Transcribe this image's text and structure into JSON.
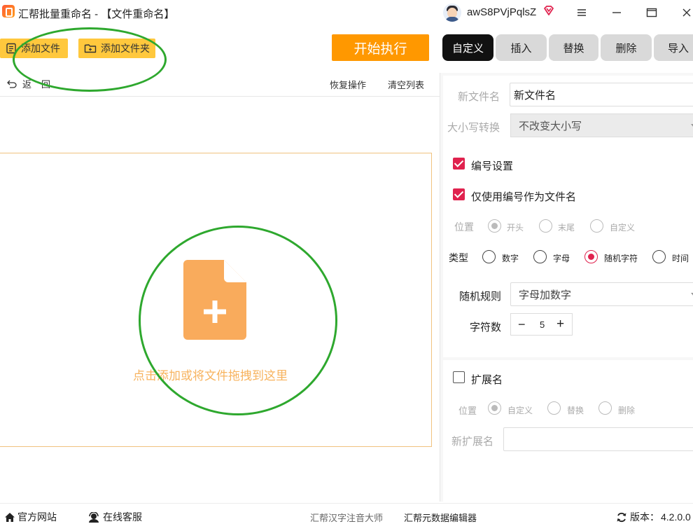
{
  "window": {
    "title": "汇帮批量重命名 - 【文件重命名】",
    "user_name": "awS8PVjPqlsZ"
  },
  "toolbar": {
    "add_file": "添加文件",
    "add_folder": "添加文件夹",
    "start": "开始执行"
  },
  "tabs": [
    {
      "label": "自定义",
      "active": true
    },
    {
      "label": "插入"
    },
    {
      "label": "替换"
    },
    {
      "label": "删除"
    },
    {
      "label": "导入"
    }
  ],
  "list_actions": {
    "back": "返",
    "back2": "回",
    "recover": "恢复操作",
    "clear": "清空列表"
  },
  "drop_zone": {
    "hint": "点击添加或将文件拖拽到这里"
  },
  "settings": {
    "new_name_label": "新文件名",
    "new_name_value": "新文件名",
    "case_label": "大小写转换",
    "case_value": "不改变大小写",
    "numbering_label": "编号设置",
    "numbering_checked": true,
    "only_number_label": "仅使用编号作为文件名",
    "only_number_checked": true,
    "position_label": "位置",
    "position_options": [
      "开头",
      "末尾",
      "自定义"
    ],
    "position_selected": "开头",
    "type_label": "类型",
    "type_options": [
      "数字",
      "字母",
      "随机字符",
      "时间"
    ],
    "type_selected": "随机字符",
    "random_rule_label": "随机规则",
    "random_rule_value": "字母加数字",
    "char_count_label": "字符数",
    "char_count_value": "5",
    "stepper_minus": "−",
    "stepper_plus": "+",
    "ext_label": "扩展名",
    "ext_checked": false,
    "ext_position_label": "位置",
    "ext_position_options": [
      "自定义",
      "替换",
      "删除"
    ],
    "ext_position_selected": "自定义",
    "new_ext_label": "新扩展名",
    "new_ext_value": ""
  },
  "statusbar": {
    "website": "官方网站",
    "support": "在线客服",
    "link1": "汇帮汉字注音大师",
    "link2": "汇帮元数据编辑器",
    "version_label": "版本：",
    "version": "4.2.0.0"
  },
  "colors": {
    "accent_yellow": "#ffc83d",
    "start_orange": "#ff9800",
    "checkbox_red": "#e0224e",
    "file_icon_orange": "#f9ab5c",
    "annotation_green": "#2ea82e"
  }
}
